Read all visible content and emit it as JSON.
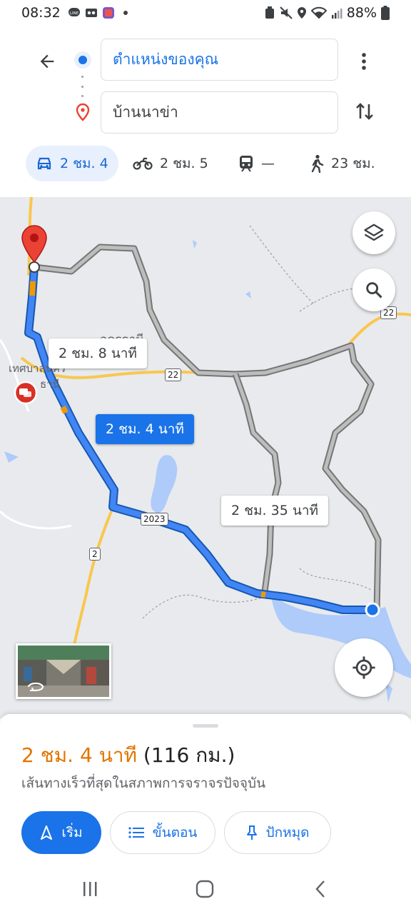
{
  "status_bar": {
    "time": "08:32",
    "battery": "88%",
    "icons": [
      "line-icon",
      "voicemail-icon",
      "app-icon",
      "dot-icon",
      "recycle-icon",
      "mute-icon",
      "location-icon",
      "wifi-icon",
      "signal-icon",
      "battery-icon"
    ]
  },
  "directions": {
    "origin_text": "ตำแหน่งของคุณ",
    "destination_text": "บ้านนาข่า",
    "modes": [
      {
        "name": "car",
        "label": "2 ชม. 4",
        "active": true
      },
      {
        "name": "motorcycle",
        "label": "2 ชม. 5",
        "active": false
      },
      {
        "name": "transit",
        "label": "—",
        "active": false
      },
      {
        "name": "walk",
        "label": "23 ชม.",
        "active": false
      }
    ]
  },
  "map": {
    "place_label": "อุดรธานี",
    "municipality_label": "เทศบาลนคร",
    "municipality_label_2": "ธานี",
    "route_labels": {
      "alt1": "2 ชม. 8 นาที",
      "main": "2 ชม. 4 นาที",
      "alt2": "2 ชม. 35 นาที"
    },
    "road_shields": [
      "22",
      "22",
      "2023",
      "2"
    ],
    "colors": {
      "route_main": "#1a73e8",
      "route_alt": "#9e9e9e",
      "traffic_slow": "#f29900",
      "destination_pin": "#ea4335",
      "water": "#aecbfa",
      "highway": "#f9c74f"
    }
  },
  "summary": {
    "time_text": "2 ชม. 4 นาที",
    "distance_text": "(116 กม.)",
    "subtitle": "เส้นทางเร็วที่สุดในสภาพการจราจรปัจจุบัน"
  },
  "actions": {
    "start_label": "เริ่ม",
    "steps_label": "ขั้นตอน",
    "pin_label": "ปักหมุด"
  }
}
